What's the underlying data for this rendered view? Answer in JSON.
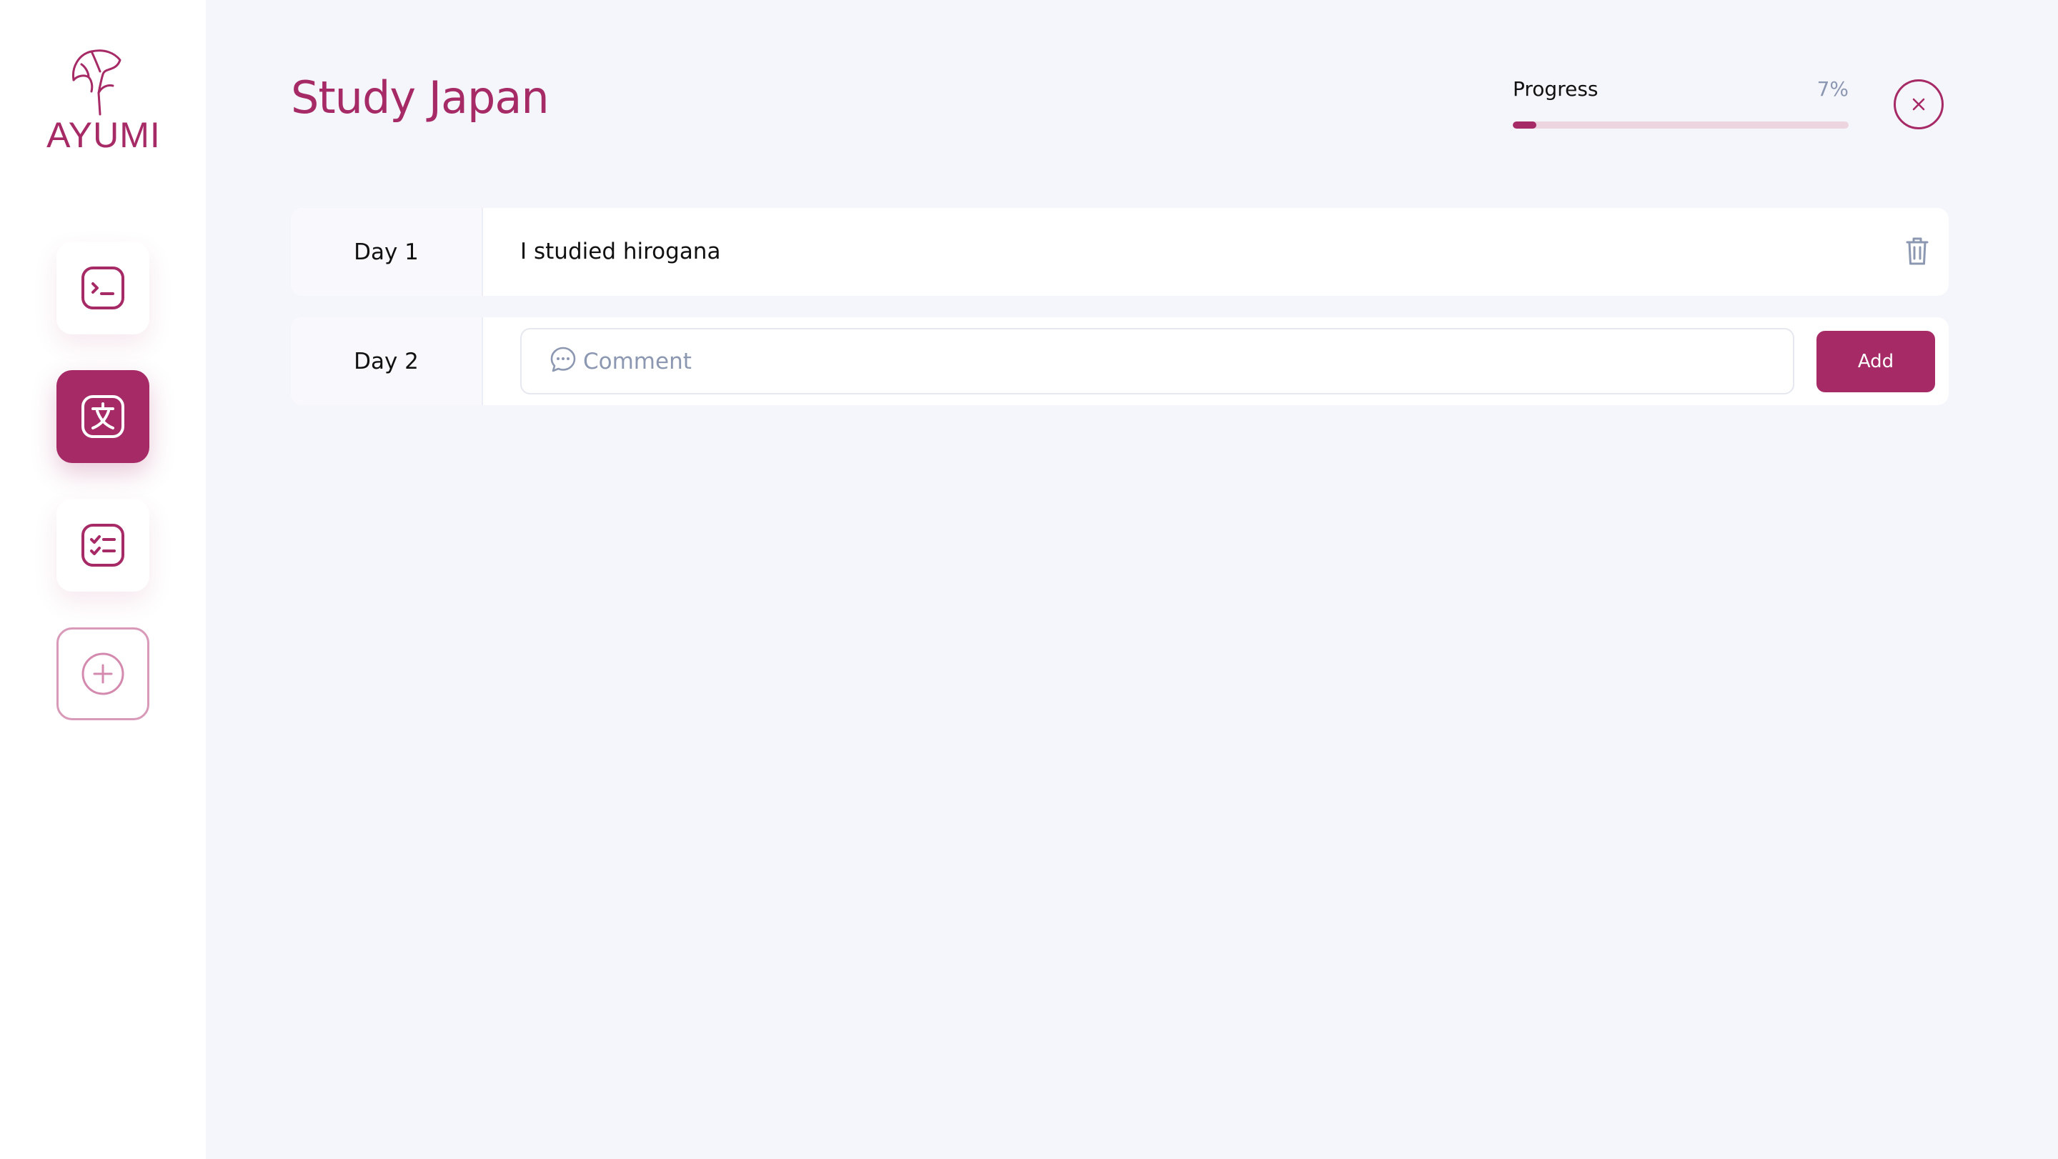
{
  "app": {
    "logo_text": "AYUMI"
  },
  "sidebar": {
    "items": [
      {
        "icon": "terminal-icon",
        "active": false
      },
      {
        "icon": "translate-icon",
        "active": true
      },
      {
        "icon": "checklist-icon",
        "active": false
      },
      {
        "icon": "plus-circle-icon",
        "active": false
      }
    ]
  },
  "header": {
    "title": "Study Japan",
    "progress_label": "Progress",
    "progress_value": "7%",
    "progress_fraction": 0.07
  },
  "entries": [
    {
      "day": "Day 1",
      "text": "I studied hirogana"
    },
    {
      "day": "Day 2",
      "comment_placeholder": "Comment",
      "add_label": "Add"
    }
  ],
  "colors": {
    "accent": "#a62a66",
    "background": "#f5f6fb",
    "muted": "#8c97b1",
    "track": "#ecd5df"
  }
}
